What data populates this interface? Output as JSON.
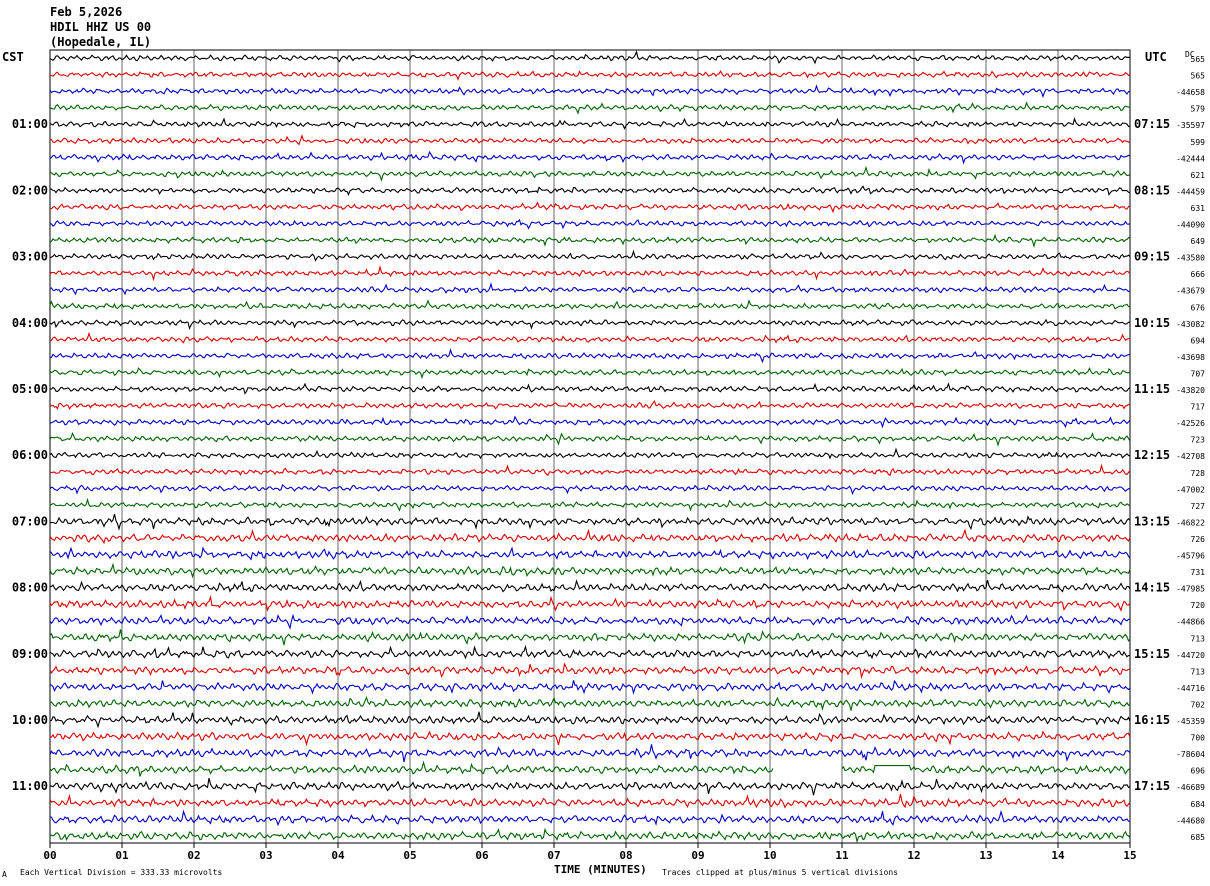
{
  "header": {
    "date": "Feb 5,2026",
    "station": "HDIL HHZ US 00",
    "location": "(Hopedale, IL)"
  },
  "left_zone": "CST",
  "right_zone": "UTC",
  "dc_label": "DC",
  "footer": {
    "scale_note": "Each Vertical Division =  333.33 microvolts",
    "clip_note": "Traces clipped at plus/minus 5 vertical divisions",
    "corner_mark": "A"
  },
  "chart_data": {
    "type": "line",
    "title": "",
    "xlabel": "TIME (MINUTES)",
    "ylabel": "",
    "xlim": [
      0,
      15
    ],
    "x_ticks": [
      "00",
      "01",
      "02",
      "03",
      "04",
      "05",
      "06",
      "07",
      "08",
      "09",
      "10",
      "11",
      "12",
      "13",
      "14",
      "15"
    ],
    "grid": true,
    "trace_colors": [
      "#000000",
      "#dd0000",
      "#0000cc",
      "#006400"
    ],
    "trace_count": 48,
    "left_time_labels": [
      {
        "row": 4,
        "label": "01:00"
      },
      {
        "row": 8,
        "label": "02:00"
      },
      {
        "row": 12,
        "label": "03:00"
      },
      {
        "row": 16,
        "label": "04:00"
      },
      {
        "row": 20,
        "label": "05:00"
      },
      {
        "row": 24,
        "label": "06:00"
      },
      {
        "row": 28,
        "label": "07:00"
      },
      {
        "row": 32,
        "label": "08:00"
      },
      {
        "row": 36,
        "label": "09:00"
      },
      {
        "row": 40,
        "label": "10:00"
      },
      {
        "row": 44,
        "label": "11:00"
      }
    ],
    "right_time_labels": [
      {
        "row": 4,
        "label": "07:15"
      },
      {
        "row": 8,
        "label": "08:15"
      },
      {
        "row": 12,
        "label": "09:15"
      },
      {
        "row": 16,
        "label": "10:15"
      },
      {
        "row": 20,
        "label": "11:15"
      },
      {
        "row": 24,
        "label": "12:15"
      },
      {
        "row": 28,
        "label": "13:15"
      },
      {
        "row": 32,
        "label": "14:15"
      },
      {
        "row": 36,
        "label": "15:15"
      },
      {
        "row": 40,
        "label": "16:15"
      },
      {
        "row": 44,
        "label": "17:15"
      }
    ],
    "dc_offsets": [
      "565",
      "565",
      "-44658",
      "579",
      "-35597",
      "599",
      "-42444",
      "621",
      "-44459",
      "631",
      "-44090",
      "649",
      "-43580",
      "666",
      "-43679",
      "676",
      "-43082",
      "694",
      "-43698",
      "707",
      "-43820",
      "717",
      "-42526",
      "723",
      "-42708",
      "728",
      "-47002",
      "727",
      "-46822",
      "726",
      "-45796",
      "731",
      "-47985",
      "720",
      "-44866",
      "713",
      "-44720",
      "713",
      "-44716",
      "702",
      "-45359",
      "700",
      "-78604",
      "696",
      "-46689",
      "684",
      "-44680",
      "685"
    ],
    "gaps": [
      {
        "row": 43,
        "start_min": 10.05,
        "end_min": 11.0
      },
      {
        "row": 43,
        "flat_start_min": 11.45,
        "flat_end_min": 11.95
      }
    ]
  }
}
